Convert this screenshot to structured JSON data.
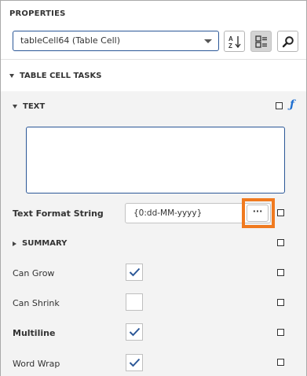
{
  "panel": {
    "title": "PROPERTIES"
  },
  "selector": {
    "value": "tableCell64 (Table Cell)"
  },
  "toolbar": {
    "sort_icon": "sort-alpha-icon",
    "categorized_icon": "categorized-icon",
    "search_icon": "search-icon"
  },
  "sections": {
    "table_cell_tasks": "TABLE CELL TASKS",
    "text": "TEXT",
    "summary": "SUMMARY"
  },
  "text_area": {
    "value": ""
  },
  "rows": {
    "text_format_string": {
      "label": "Text Format String",
      "value": "{0:dd-MM-yyyy}",
      "button_label": "···"
    },
    "can_grow": {
      "label": "Can Grow",
      "checked": true
    },
    "can_shrink": {
      "label": "Can Shrink",
      "checked": false
    },
    "multiline": {
      "label": "Multiline",
      "checked": true
    },
    "word_wrap": {
      "label": "Word Wrap",
      "checked": true
    }
  },
  "colors": {
    "accent": "#2b5797",
    "highlight": "#f07a1f",
    "check": "#2b5797",
    "fx": "#1f6fd0"
  }
}
